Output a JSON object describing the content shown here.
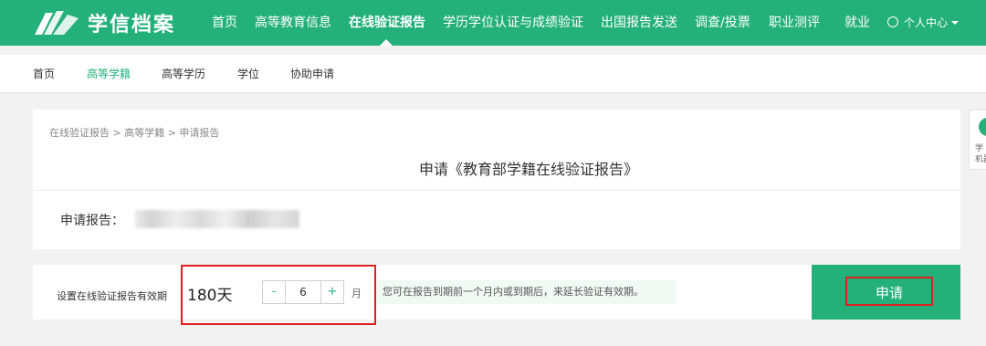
{
  "brand": {
    "name": "学信档案"
  },
  "nav": {
    "items": [
      {
        "id": "home",
        "label": "首页"
      },
      {
        "id": "higher-edu-info",
        "label": "高等教育信息"
      },
      {
        "id": "online-report",
        "label": "在线验证报告"
      },
      {
        "id": "degree-cert",
        "label": "学历学位认证与成绩验证"
      },
      {
        "id": "overseas-report",
        "label": "出国报告发送"
      },
      {
        "id": "survey",
        "label": "调查/投票"
      },
      {
        "id": "career-test",
        "label": "职业测评"
      },
      {
        "id": "employment",
        "label": "就业"
      }
    ],
    "active": "在线验证报告",
    "user_center": "个人中心"
  },
  "subnav": {
    "items": [
      "首页",
      "高等学籍",
      "高等学历",
      "学位",
      "协助申请"
    ],
    "active": "高等学籍"
  },
  "breadcrumb": "在线验证报告 > 高等学籍 > 申请报告",
  "report": {
    "title": "申请《教育部学籍在线验证报告》",
    "apply_label": "申请报告："
  },
  "validity": {
    "label": "设置在线验证报告有效期",
    "days": "180天",
    "minus": "-",
    "value": "6",
    "plus": "+",
    "unit": "月",
    "hint": "您可在报告到期前一个月内或到期后，来延长验证有效期。"
  },
  "submit": {
    "label": "申请"
  },
  "side_widget": {
    "text_line1": "学",
    "text_line2": "机器"
  },
  "colors": {
    "brand_green": "#24b07a",
    "highlight_red": "#e02020"
  },
  "icons": [
    "logo-book-icon",
    "user-circle-icon",
    "chevron-down-icon"
  ]
}
